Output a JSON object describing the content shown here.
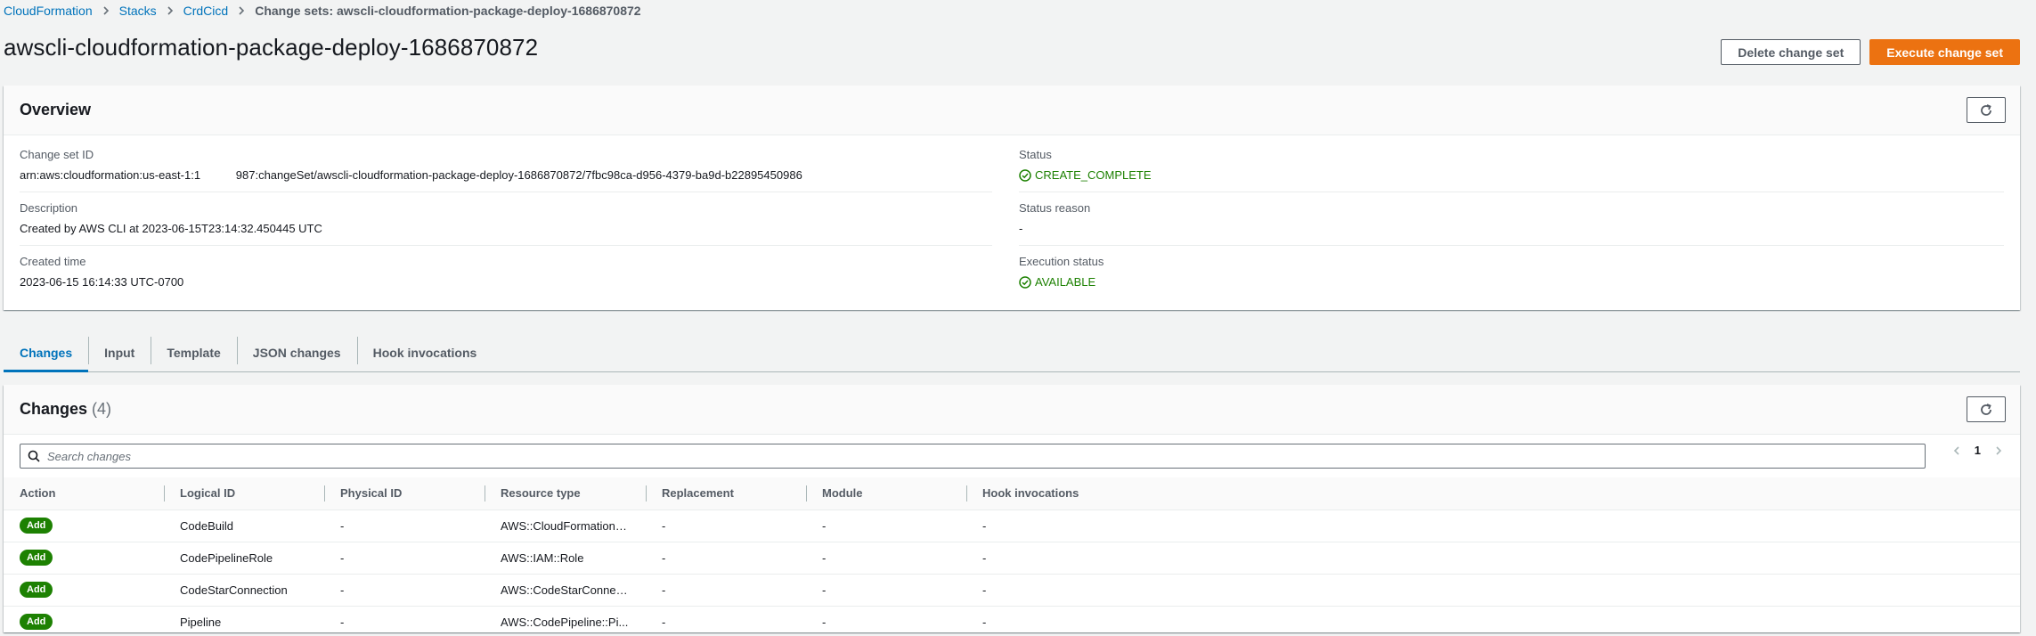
{
  "breadcrumb": {
    "items": [
      "CloudFormation",
      "Stacks",
      "CrdCicd"
    ],
    "current": "Change sets: awscli-cloudformation-package-deploy-1686870872"
  },
  "header": {
    "title": "awscli-cloudformation-package-deploy-1686870872",
    "delete_label": "Delete change set",
    "execute_label": "Execute change set"
  },
  "overview": {
    "title": "Overview",
    "change_set_id_label": "Change set ID",
    "change_set_id": "arn:aws:cloudformation:us-east-1:1           987:changeSet/awscli-cloudformation-package-deploy-1686870872/7fbc98ca-d956-4379-ba9d-b22895450986",
    "status_label": "Status",
    "status": "CREATE_COMPLETE",
    "description_label": "Description",
    "description": "Created by AWS CLI at 2023-06-15T23:14:32.450445 UTC",
    "status_reason_label": "Status reason",
    "status_reason": "-",
    "created_time_label": "Created time",
    "created_time": "2023-06-15 16:14:33 UTC-0700",
    "execution_status_label": "Execution status",
    "execution_status": "AVAILABLE"
  },
  "tabs": [
    "Changes",
    "Input",
    "Template",
    "JSON changes",
    "Hook invocations"
  ],
  "active_tab": "Changes",
  "changes": {
    "title": "Changes",
    "count": "(4)",
    "search_placeholder": "Search changes",
    "page": "1",
    "columns": [
      "Action",
      "Logical ID",
      "Physical ID",
      "Resource type",
      "Replacement",
      "Module",
      "Hook invocations"
    ],
    "rows": [
      {
        "action": "Add",
        "logical_id": "CodeBuild",
        "physical_id": "-",
        "resource_type": "AWS::CloudFormation::...",
        "replacement": "-",
        "module": "-",
        "hook_invocations": "-"
      },
      {
        "action": "Add",
        "logical_id": "CodePipelineRole",
        "physical_id": "-",
        "resource_type": "AWS::IAM::Role",
        "replacement": "-",
        "module": "-",
        "hook_invocations": "-"
      },
      {
        "action": "Add",
        "logical_id": "CodeStarConnection",
        "physical_id": "-",
        "resource_type": "AWS::CodeStarConnec...",
        "replacement": "-",
        "module": "-",
        "hook_invocations": "-"
      },
      {
        "action": "Add",
        "logical_id": "Pipeline",
        "physical_id": "-",
        "resource_type": "AWS::CodePipeline::Pi...",
        "replacement": "-",
        "module": "-",
        "hook_invocations": "-"
      }
    ]
  },
  "colors": {
    "link": "#0073bb",
    "primary_button": "#ec7211",
    "success": "#1d8102",
    "background": "#f2f3f3"
  },
  "icons": {
    "breadcrumb_separator": "chevron-right-icon",
    "refresh": "refresh-icon",
    "status_ok": "check-circle-icon",
    "search": "search-icon",
    "prev_page": "chevron-left-icon",
    "next_page": "chevron-right-icon"
  }
}
